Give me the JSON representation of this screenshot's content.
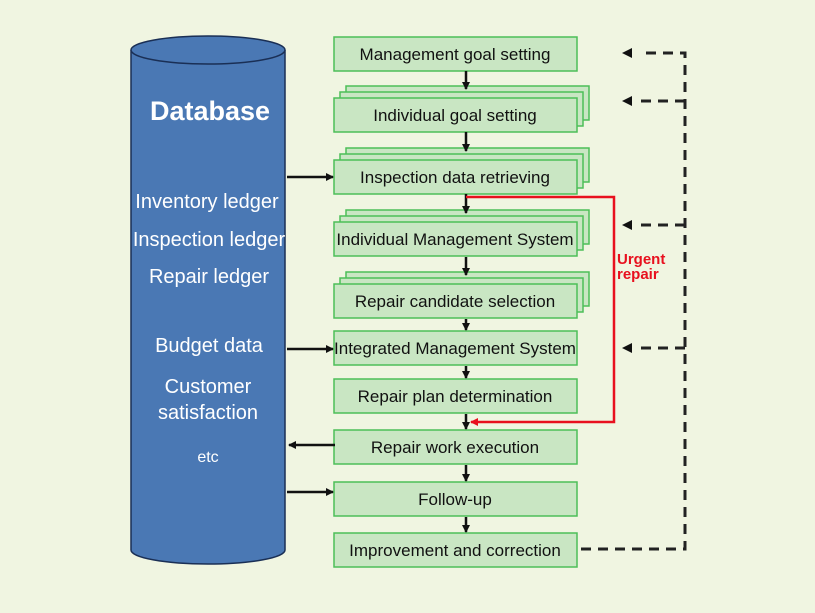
{
  "database": {
    "title": "Database",
    "items": [
      "Inventory ledger",
      "Inspection ledger",
      "Repair ledger",
      "Budget data",
      "Customer",
      "satisfaction",
      "etc"
    ],
    "color": "#4a78b4"
  },
  "steps": [
    {
      "label": "Management goal setting",
      "stacked": false
    },
    {
      "label": "Individual goal setting",
      "stacked": true
    },
    {
      "label": "Inspection data retrieving",
      "stacked": true
    },
    {
      "label": "Individual Management System",
      "stacked": true
    },
    {
      "label": "Repair candidate selection",
      "stacked": true
    },
    {
      "label": "Integrated Management System",
      "stacked": false
    },
    {
      "label": "Repair plan determination",
      "stacked": false
    },
    {
      "label": "Repair work execution",
      "stacked": false
    },
    {
      "label": "Follow-up",
      "stacked": false
    },
    {
      "label": "Improvement and correction",
      "stacked": false
    }
  ],
  "urgent": {
    "line1": "Urgent",
    "line2": "repair",
    "color": "#e8101e"
  },
  "colors": {
    "background": "#f0f5e1",
    "box_fill": "#c9e6c3",
    "box_border": "#4cbf58"
  }
}
